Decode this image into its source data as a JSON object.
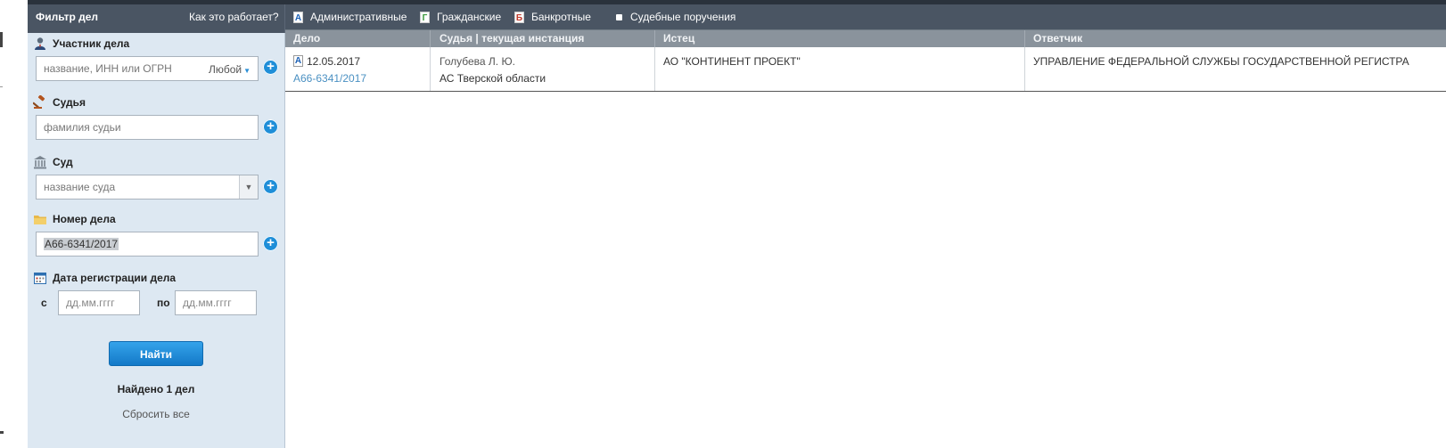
{
  "topbar": {
    "title": "Фильтр дел",
    "how_it_works": "Как это работает?",
    "tabs": [
      {
        "badge": "А",
        "label": "Административные"
      },
      {
        "badge": "Г",
        "label": "Гражданские"
      },
      {
        "badge": "Б",
        "label": "Банкротные"
      },
      {
        "label": "Судебные поручения"
      }
    ]
  },
  "sidebar": {
    "participant": {
      "label": "Участник дела",
      "placeholder": "название, ИНН или ОГРН",
      "role": "Любой"
    },
    "judge": {
      "label": "Судья",
      "placeholder": "фамилия судьи"
    },
    "court": {
      "label": "Суд",
      "placeholder": "название суда"
    },
    "case_number": {
      "label": "Номер дела",
      "value": "А66-6341/2017"
    },
    "date": {
      "label": "Дата регистрации дела",
      "from_label": "с",
      "to_label": "по",
      "from_placeholder": "дд.мм.гггг",
      "to_placeholder": "дд.мм.гггг"
    },
    "find_button": "Найти",
    "found_text": "Найдено 1 дел",
    "reset_text": "Сбросить все"
  },
  "table": {
    "headers": [
      "Дело",
      "Судья | текущая инстанция",
      "Истец",
      "Ответчик"
    ],
    "rows": [
      {
        "badge": "А",
        "date": "12.05.2017",
        "case_link": "А66-6341/2017",
        "judge": "Голубева Л. Ю.",
        "court": "АС Тверской области",
        "plaintiff": "АО \"КОНТИНЕНТ ПРОЕКТ\"",
        "defendant": "УПРАВЛЕНИЕ ФЕДЕРАЛЬНОЙ СЛУЖБЫ ГОСУДАРСТВЕННОЙ РЕГИСТРА"
      }
    ]
  },
  "icons": {
    "participant": "person-icon",
    "judge": "gavel-icon",
    "court": "courthouse-icon",
    "case_number": "folder-icon",
    "date": "calendar-icon",
    "add": "plus-circle-icon"
  },
  "colors": {
    "topbar": "#4a5563",
    "sidebar": "#dde8f2",
    "accent": "#1e8ed8",
    "table_header": "#8a939c",
    "link": "#4a90c2"
  }
}
